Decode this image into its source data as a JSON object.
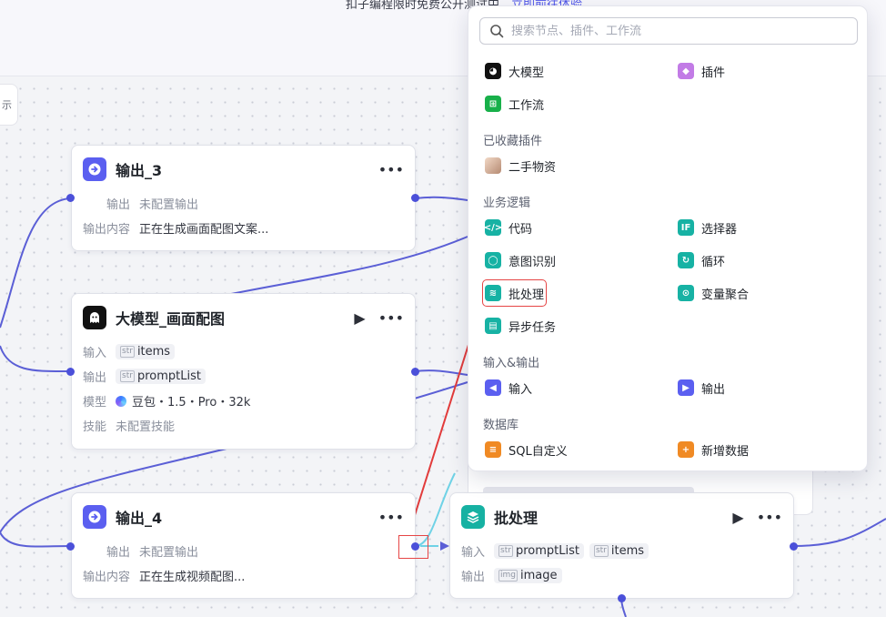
{
  "banner": {
    "text": "扣子编程限时免费公开测试中，",
    "link": "立即前往体验"
  },
  "left_tab": "示",
  "nodes": {
    "output3": {
      "title": "输出_3",
      "rows": [
        {
          "label": "输出",
          "value": "未配置输出"
        },
        {
          "label": "输出内容",
          "value": "正在生成画面配图文案..."
        }
      ]
    },
    "llm": {
      "title": "大模型_画面配图",
      "input_label": "输入",
      "input_tag": "items",
      "output_label": "输出",
      "output_tag": "promptList",
      "model_label": "模型",
      "model_value": "豆包・1.5・Pro・32k",
      "skill_label": "技能",
      "skill_value": "未配置技能"
    },
    "output4": {
      "title": "输出_4",
      "rows": [
        {
          "label": "输出",
          "value": "未配置输出"
        },
        {
          "label": "输出内容",
          "value": "正在生成视频配图..."
        }
      ]
    },
    "batch": {
      "title": "批处理",
      "input_label": "输入",
      "input_tags": [
        "promptList",
        "items"
      ],
      "output_label": "输出",
      "output_tag": "image"
    }
  },
  "popup": {
    "search_placeholder": "搜索节点、插件、工作流",
    "top_items": {
      "llm": "大模型",
      "plugin": "插件",
      "workflow": "工作流"
    },
    "favorites_title": "已收藏插件",
    "favorites": [
      "二手物资"
    ],
    "logic_title": "业务逻辑",
    "logic": {
      "code": "代码",
      "selector": "选择器",
      "intent": "意图识别",
      "loop": "循环",
      "batch": "批处理",
      "aggregate": "变量聚合",
      "async": "异步任务"
    },
    "io_title": "输入&输出",
    "io": {
      "input": "输入",
      "output": "输出"
    },
    "db_title": "数据库",
    "db": {
      "sql": "SQL自定义",
      "add": "新增数据"
    }
  },
  "icons": {
    "node_output": "output-arrow-icon",
    "node_llm": "llm-ghost-icon",
    "node_batch": "layers-icon",
    "more": "more-dots-icon",
    "run": "play-icon",
    "search": "search-icon"
  },
  "colors": {
    "accent": "#4d53e8",
    "annotation": "#e64545",
    "teal": "#16b1a2"
  }
}
